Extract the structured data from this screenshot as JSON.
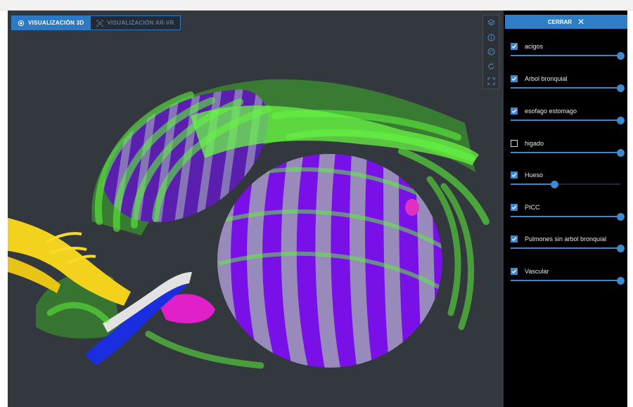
{
  "viewer": {
    "tab_3d": "VISUALIZACIÓN 3D",
    "tab_arvr": "VISUALIZACIÓN AR-VR",
    "toolbar": [
      "layers-icon",
      "info-icon",
      "palette-icon",
      "rotate-icon",
      "fullscreen-icon"
    ]
  },
  "panel": {
    "close_label": "CERRAR",
    "close_icon": "close-icon",
    "layers": [
      {
        "label": "acigos",
        "checked": true,
        "opacity": 1.0
      },
      {
        "label": "Arbol bronquial",
        "checked": true,
        "opacity": 1.0
      },
      {
        "label": "esofago estomago",
        "checked": true,
        "opacity": 1.0
      },
      {
        "label": "higado",
        "checked": false,
        "opacity": 1.0
      },
      {
        "label": "Hueso",
        "checked": true,
        "opacity": 0.4
      },
      {
        "label": "PICC",
        "checked": true,
        "opacity": 1.0
      },
      {
        "label": "Pulmones sin arbol bronquial",
        "checked": true,
        "opacity": 1.0
      },
      {
        "label": "Vascular",
        "checked": true,
        "opacity": 1.0
      }
    ]
  },
  "colors": {
    "accent": "#2f7ec5",
    "viewport_bg": "#33373e",
    "bone": "#4cf52a",
    "lungs": "#7a10e8",
    "trachea": "#f2d21c",
    "vascular": "#1a2ee0",
    "picc": "#dcdcdc",
    "esophagus": "#e020c8"
  }
}
